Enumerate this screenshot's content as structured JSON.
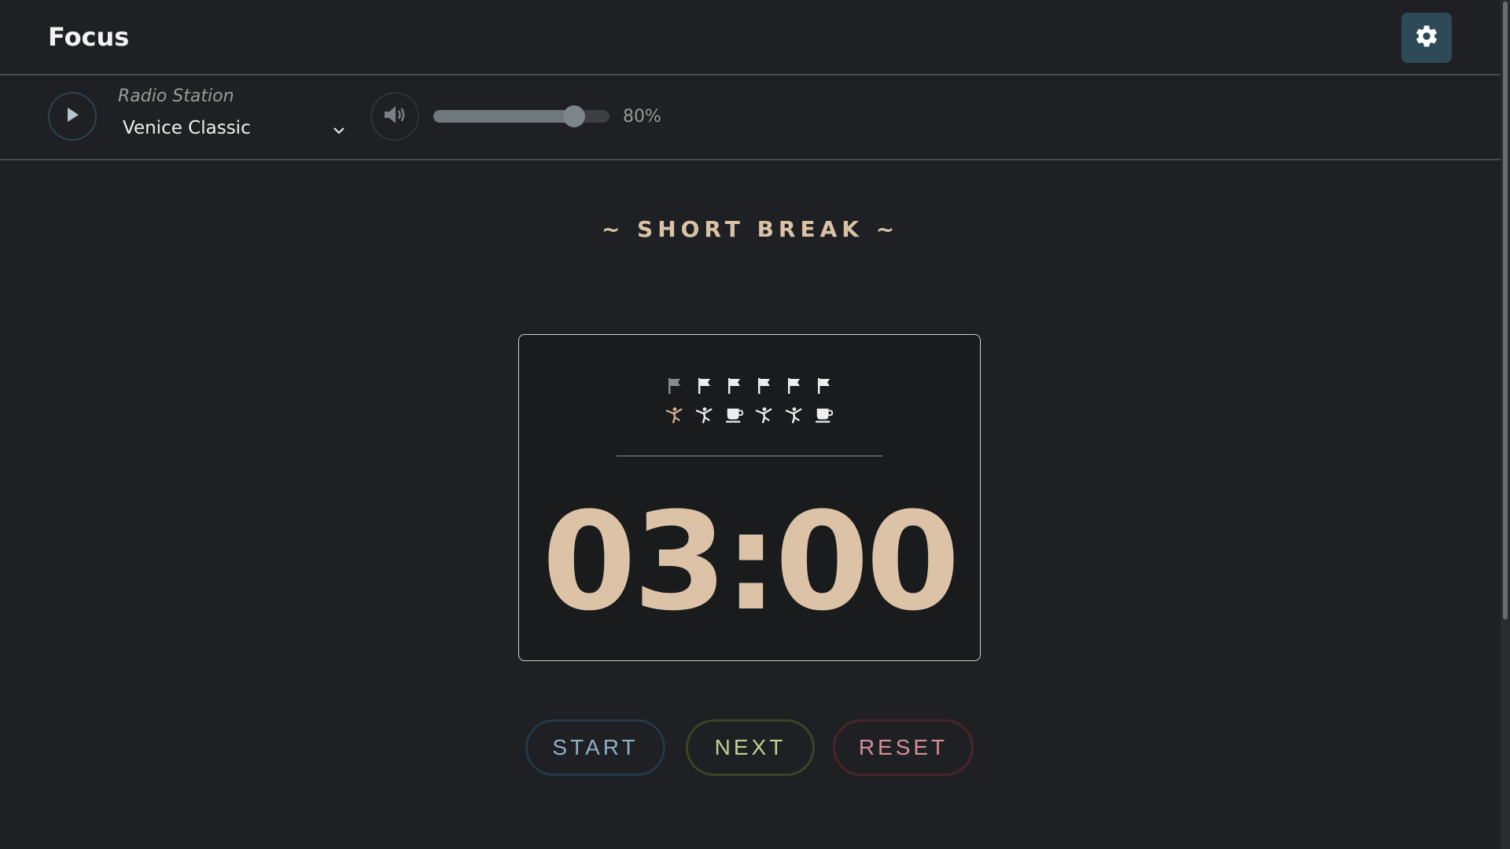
{
  "app": {
    "title": "Focus"
  },
  "header": {
    "settings_icon": "gear-icon"
  },
  "radio": {
    "label": "Radio Station",
    "station": "Venice Classic",
    "play_icon": "play-icon",
    "volume_icon": "volume-icon",
    "volume_percent": 80,
    "volume_text": "80%"
  },
  "timer": {
    "mode_title": "~ SHORT BREAK ~",
    "time": "03:00",
    "flags": [
      {
        "icon": "flag-icon",
        "state": "current"
      },
      {
        "icon": "flag-icon",
        "state": "pending"
      },
      {
        "icon": "flag-icon",
        "state": "pending"
      },
      {
        "icon": "flag-icon",
        "state": "pending"
      },
      {
        "icon": "flag-icon",
        "state": "pending"
      },
      {
        "icon": "flag-icon",
        "state": "pending"
      }
    ],
    "activities": [
      {
        "icon": "stretch-icon",
        "state": "active"
      },
      {
        "icon": "stretch-icon",
        "state": "pending"
      },
      {
        "icon": "coffee-icon",
        "state": "pending"
      },
      {
        "icon": "stretch-icon",
        "state": "pending"
      },
      {
        "icon": "stretch-icon",
        "state": "pending"
      },
      {
        "icon": "coffee-icon",
        "state": "pending"
      }
    ]
  },
  "controls": {
    "start": "START",
    "next": "NEXT",
    "reset": "RESET"
  },
  "colors": {
    "background": "#1f2023",
    "accent": "#dcc3a7",
    "settings_bg": "#2e4a59",
    "start": "#8fb1c6",
    "next": "#c4cf94",
    "reset": "#d48f99"
  }
}
